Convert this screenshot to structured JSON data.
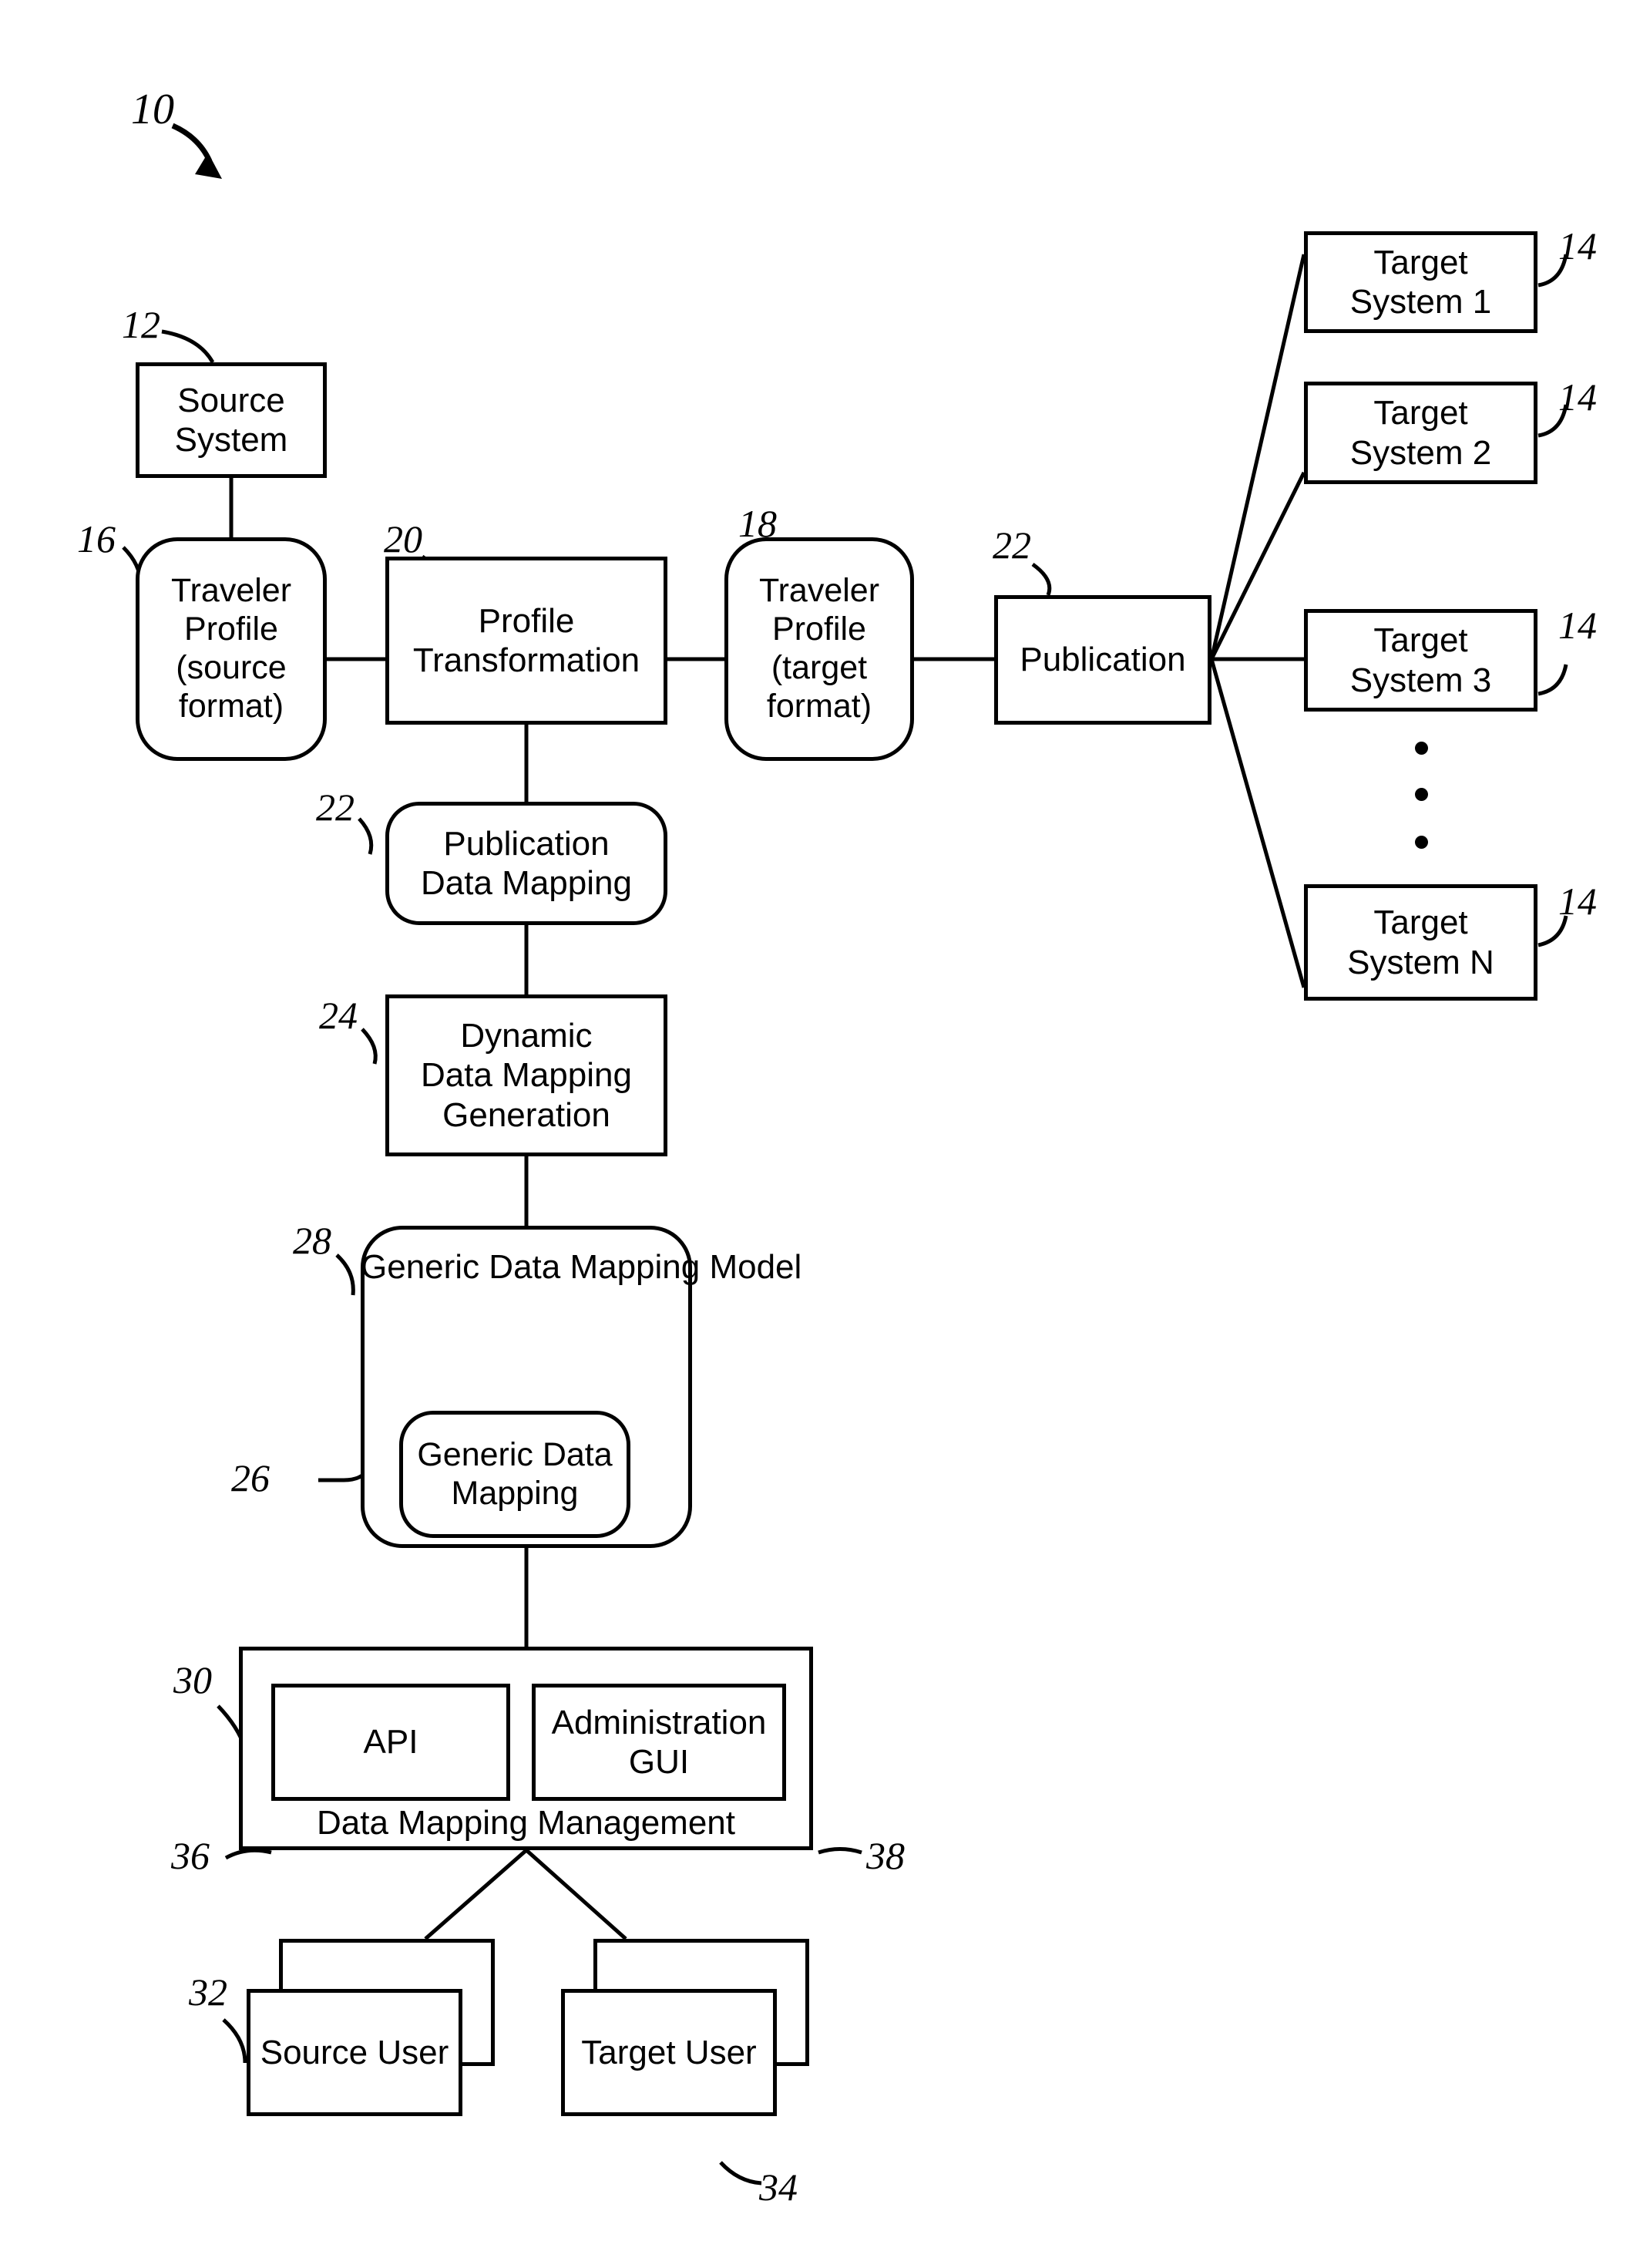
{
  "figure": {
    "figure_ref": "10",
    "nodes": {
      "source_system": "Source System",
      "traveler_profile_source": "Traveler\nProfile\n(source\nformat)",
      "profile_transformation": "Profile\nTransformation",
      "traveler_profile_target": "Traveler\nProfile\n(target\nformat)",
      "publication": "Publication",
      "publication_data_mapping": "Publication\nData Mapping",
      "dynamic_data_mapping_generation": "Dynamic\nData Mapping\nGeneration",
      "generic_data_mapping_model": "Generic Data\nMapping Model",
      "generic_data_mapping": "Generic Data\nMapping",
      "api": "API",
      "administration_gui": "Administration\nGUI",
      "data_mapping_management": "Data Mapping Management",
      "source_user": "Source User",
      "target_user": "Target User"
    },
    "target_systems": [
      {
        "label": "Target\nSystem 1",
        "ref": "14"
      },
      {
        "label": "Target\nSystem 2",
        "ref": "14"
      },
      {
        "label": "Target\nSystem 3",
        "ref": "14"
      },
      {
        "label": "Target\nSystem N",
        "ref": "14"
      }
    ],
    "reference_numerals": {
      "source_system": "12",
      "traveler_profile_source": "16",
      "profile_transformation": "20",
      "traveler_profile_target": "18",
      "publication": "22",
      "publication_data_mapping": "22",
      "dynamic_data_mapping_generation": "24",
      "generic_data_mapping_model": "28",
      "generic_data_mapping": "26",
      "data_mapping_management": "30",
      "api": "36",
      "administration_gui": "38",
      "source_user": "32",
      "target_user": "34"
    },
    "ellipsis_dots": 3,
    "colors": {
      "ink": "#000000",
      "paper": "#ffffff"
    }
  }
}
